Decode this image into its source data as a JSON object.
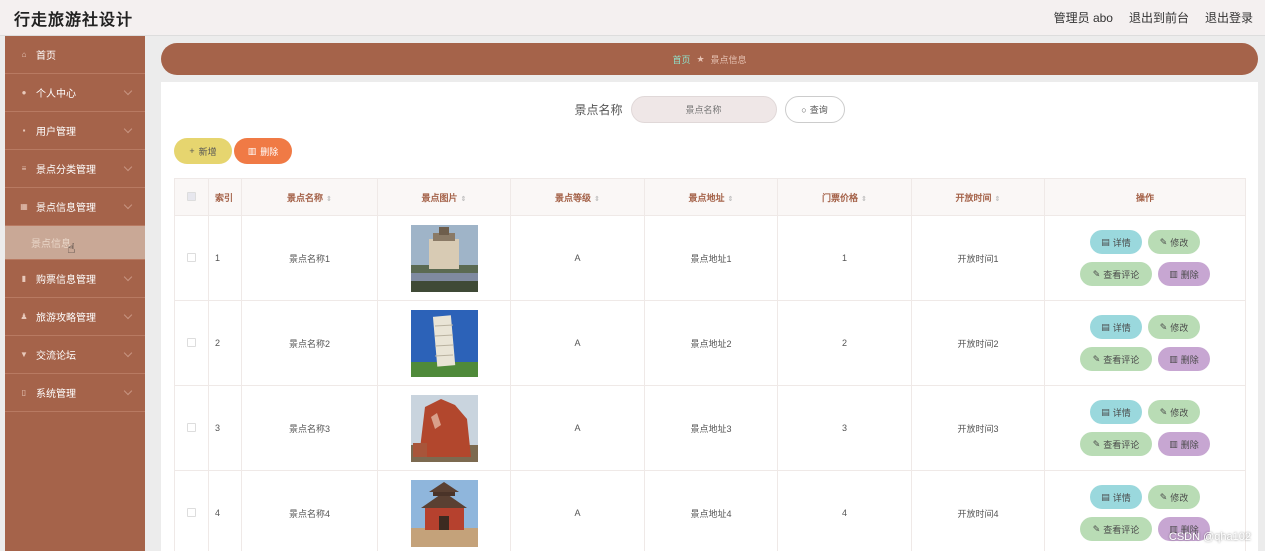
{
  "header": {
    "title": "行走旅游社设计",
    "admin_label": "管理员 abo",
    "to_front": "退出到前台",
    "logout": "退出登录"
  },
  "sidebar": {
    "items": [
      {
        "label": "首页",
        "icon": "home-icon"
      },
      {
        "label": "个人中心",
        "icon": "user-icon"
      },
      {
        "label": "用户管理",
        "icon": "users-icon"
      },
      {
        "label": "景点分类管理",
        "icon": "list-icon"
      },
      {
        "label": "景点信息管理",
        "icon": "grid-icon"
      },
      {
        "label": "购票信息管理",
        "icon": "chart-icon"
      },
      {
        "label": "旅游攻略管理",
        "icon": "person-icon"
      },
      {
        "label": "交流论坛",
        "icon": "filter-icon"
      },
      {
        "label": "系统管理",
        "icon": "phone-icon"
      }
    ],
    "active_sub": "景点信息"
  },
  "breadcrumb": {
    "home": "首页",
    "separator": "★",
    "current": "景点信息"
  },
  "search": {
    "label": "景点名称",
    "placeholder": "景点名称",
    "button": "查询"
  },
  "toolbar": {
    "add": "新增",
    "delete": "删除"
  },
  "table": {
    "columns": [
      "索引",
      "景点名称",
      "景点图片",
      "景点等级",
      "景点地址",
      "门票价格",
      "开放时间",
      "操作"
    ],
    "rows": [
      {
        "index": "1",
        "name": "景点名称1",
        "level": "A",
        "address": "景点地址1",
        "price": "1",
        "open": "开放时间1"
      },
      {
        "index": "2",
        "name": "景点名称2",
        "level": "A",
        "address": "景点地址2",
        "price": "2",
        "open": "开放时间2"
      },
      {
        "index": "3",
        "name": "景点名称3",
        "level": "A",
        "address": "景点地址3",
        "price": "3",
        "open": "开放时间3"
      },
      {
        "index": "4",
        "name": "景点名称4",
        "level": "A",
        "address": "景点地址4",
        "price": "4",
        "open": "开放时间4"
      }
    ],
    "actions": {
      "detail": "详情",
      "edit": "修改",
      "comments": "查看评论",
      "remove": "删除"
    }
  },
  "watermark": "CSDN @qha102",
  "colors": {
    "brand": "#a5634a",
    "add": "#e6d56f",
    "delete": "#f07a45",
    "detail": "#9ad8dd",
    "edit": "#b9dcb5",
    "remove": "#c7a6d2"
  }
}
